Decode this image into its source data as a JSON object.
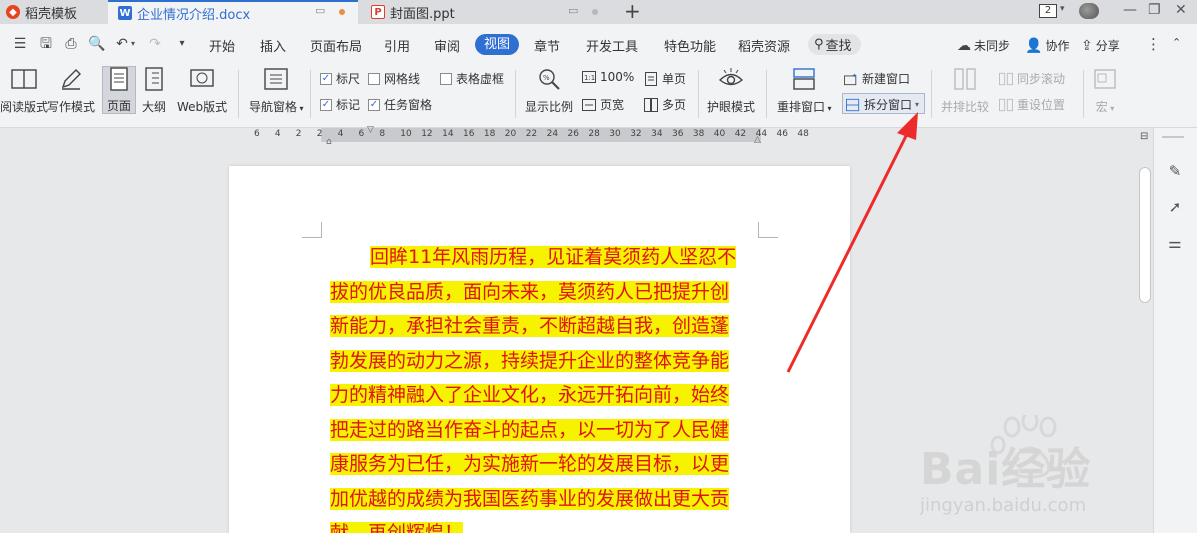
{
  "tabs": [
    {
      "label": "稻壳模板"
    },
    {
      "label": "企业情况介绍.docx"
    },
    {
      "label": "封面图.ppt"
    }
  ],
  "window": {
    "count_badge": "2"
  },
  "menu": {
    "items": [
      "开始",
      "插入",
      "页面布局",
      "引用",
      "审阅",
      "视图",
      "章节",
      "开发工具",
      "特色功能",
      "稻壳资源"
    ],
    "active": "视图",
    "search": "查找",
    "right": [
      "未同步",
      "协作",
      "分享"
    ]
  },
  "ribbon": {
    "read_mode": "阅读版式",
    "write_mode": "写作模式",
    "page": "页面",
    "outline": "大纲",
    "web": "Web版式",
    "nav_pane": "导航窗格",
    "ruler": "标尺",
    "gridlines": "网格线",
    "table_virtual": "表格虚框",
    "marks": "标记",
    "task_pane": "任务窗格",
    "zoom": "显示比例",
    "zoom_100": "100%",
    "page_width": "页宽",
    "single_page": "单页",
    "multi_page": "多页",
    "eye_mode": "护眼模式",
    "rearrange": "重排窗口",
    "new_window": "新建窗口",
    "split_window": "拆分窗口",
    "side_compare": "并排比较",
    "sync_scroll": "同步滚动",
    "reset_pos": "重设位置",
    "macro": "宏"
  },
  "ruler": {
    "numbers": [
      "6",
      "4",
      "2",
      "2",
      "4",
      "6",
      "8",
      "10",
      "12",
      "14",
      "16",
      "18",
      "20",
      "22",
      "24",
      "26",
      "28",
      "30",
      "32",
      "34",
      "36",
      "38",
      "40",
      "42",
      "44",
      "46",
      "48"
    ]
  },
  "document": {
    "lines": [
      "回眸11年风雨历程，见证着莫须药人坚忍不",
      "拔的优良品质，面向未来，莫须药人已把提升创",
      "新能力，承担社会重责，不断超越自我，创造蓬",
      "勃发展的动力之源，持续提升企业的整体竞争能",
      "力的精神融入了企业文化，永远开拓向前，始终",
      "把走过的路当作奋斗的起点，以一切为了人民健",
      "康服务为已任，为实施新一轮的发展目标，以更",
      "加优越的成绩为我国医药事业的发展做出更大贡",
      "献，再创辉煌！"
    ]
  },
  "watermark": {
    "text": "Bai经验",
    "url": "jingyan.baidu.com"
  },
  "colors": {
    "accent": "#2f6fd1",
    "highlight": "#f7f200",
    "doc_text": "#e01414",
    "arrow": "#ee2b2b"
  }
}
